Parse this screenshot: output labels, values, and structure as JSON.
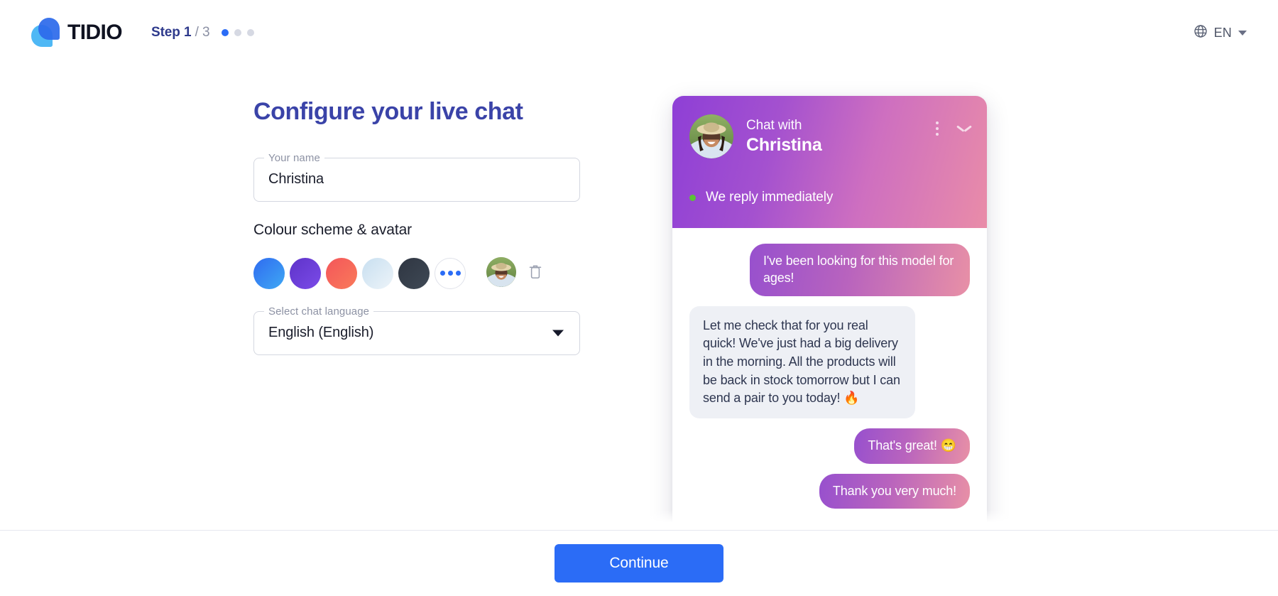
{
  "header": {
    "logo_text": "TIDIO",
    "step_label": "Step 1",
    "step_total": "/ 3",
    "steps_current": 1,
    "steps_total": 3,
    "language_code": "EN"
  },
  "main": {
    "title": "Configure your live chat",
    "name_field": {
      "label": "Your name",
      "value": "Christina"
    },
    "colour_section_title": "Colour scheme & avatar",
    "swatches": [
      {
        "name": "blue",
        "from": "#2F6BF0",
        "to": "#3FA8F4"
      },
      {
        "name": "purple",
        "from": "#5E33C9",
        "to": "#7B4BE8"
      },
      {
        "name": "coral",
        "from": "#F4565A",
        "to": "#F97A5A"
      },
      {
        "name": "pale-blue",
        "from": "#C8DFF0",
        "to": "#E7F0F7"
      },
      {
        "name": "charcoal",
        "from": "#2F3642",
        "to": "#3E4753"
      }
    ],
    "more_colours_label": "More colours",
    "language_field": {
      "label": "Select chat language",
      "value": "English (English)"
    }
  },
  "preview": {
    "header": {
      "subtitle": "Chat with",
      "name": "Christina",
      "status": "We reply immediately",
      "gradient_from": "#8E3FD6",
      "gradient_to": "#E98CA8",
      "status_dot_color": "#5BC236"
    },
    "messages": [
      {
        "direction": "out",
        "text": "I've been looking for this model for ages!"
      },
      {
        "direction": "in",
        "text": "Let me check that for you real quick! We've just had a big delivery in the morning. All the products will be back in stock tomorrow but I can send a pair to you today! 🔥"
      },
      {
        "direction": "out",
        "text": "That's great! 😁"
      },
      {
        "direction": "out",
        "text": "Thank you very much!"
      }
    ]
  },
  "footer": {
    "continue_label": "Continue",
    "accent_color": "#2B6CF6"
  }
}
